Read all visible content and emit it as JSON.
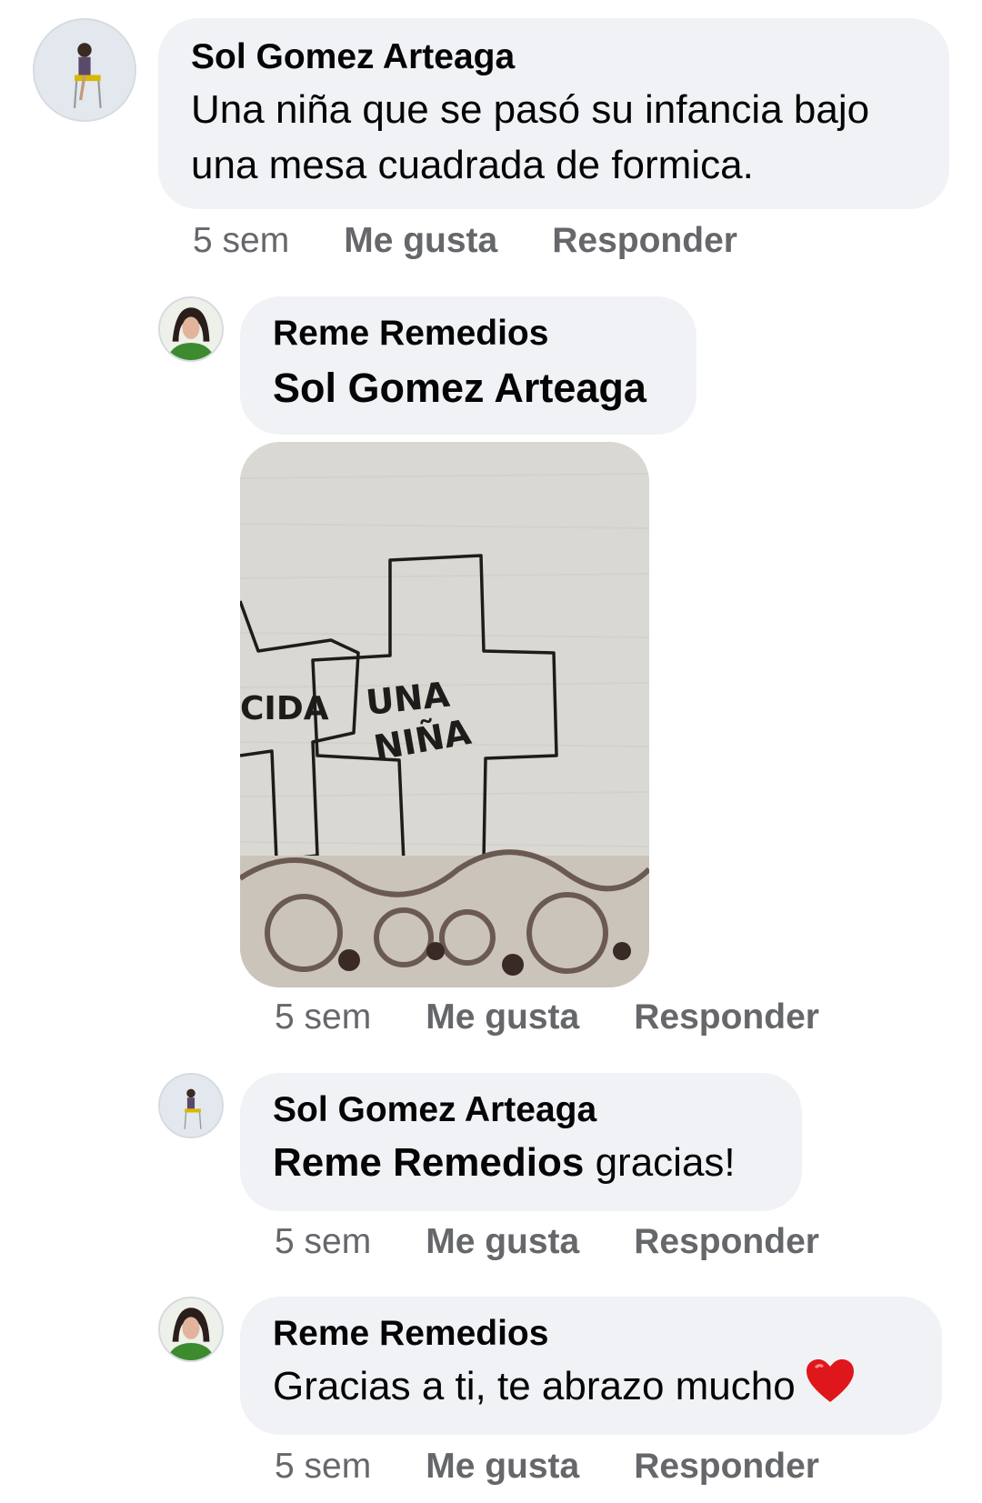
{
  "comments": [
    {
      "author": "Sol Gomez Arteaga",
      "text": "Una niña que se pasó su infancia bajo una mesa cuadrada de formica.",
      "time": "5 sem",
      "like": "Me gusta",
      "reply": "Responder"
    },
    {
      "author": "Reme Remedios",
      "mention": "Sol Gomez Arteaga",
      "time": "5 sem",
      "like": "Me gusta",
      "reply": "Responder",
      "photo_text": "UNA NIÑA"
    },
    {
      "author": "Sol Gomez Arteaga",
      "mention": "Reme Remedios",
      "text": " gracias!",
      "time": "5 sem",
      "like": "Me gusta",
      "reply": "Responder"
    },
    {
      "author": "Reme Remedios",
      "text": "Gracias a ti, te abrazo mucho",
      "time": "5 sem",
      "like": "Me gusta",
      "reply": "Responder",
      "emoji": "red-heart"
    }
  ],
  "colors": {
    "bubble": "#f0f2f5",
    "meta": "#65676b",
    "heart": "#e0161d"
  }
}
